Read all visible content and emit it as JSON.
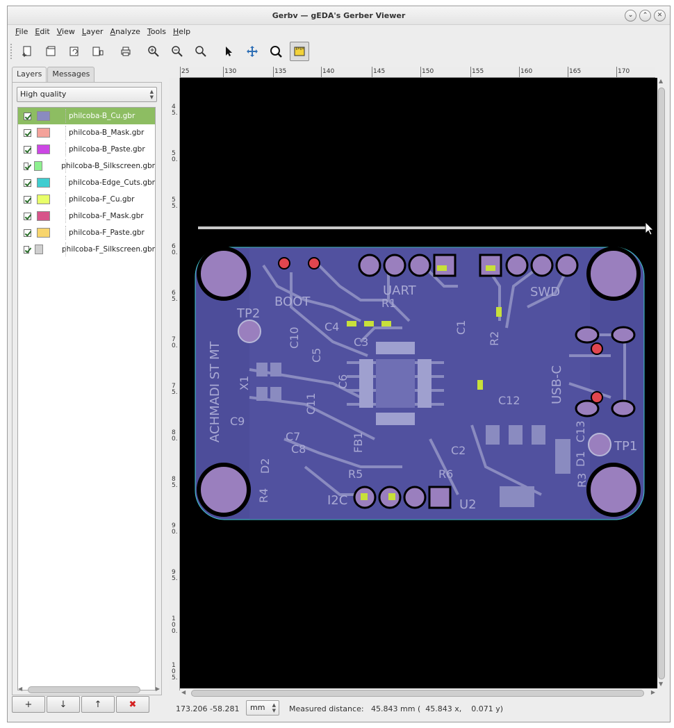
{
  "window": {
    "title": "Gerbv — gEDA's Gerber Viewer"
  },
  "menu": [
    "File",
    "Edit",
    "View",
    "Layer",
    "Analyze",
    "Tools",
    "Help"
  ],
  "toolbar": {
    "icons": [
      "new-project-icon",
      "open-project-icon",
      "revert-icon",
      "save-as-icon",
      "print-icon",
      "zoom-in-icon",
      "zoom-out-icon",
      "zoom-fit-icon",
      "pointer-tool-icon",
      "pan-tool-icon",
      "zoom-tool-icon",
      "measure-tool-icon"
    ],
    "active": "measure-tool-icon"
  },
  "sidebar": {
    "tabs": [
      "Layers",
      "Messages"
    ],
    "active_tab": "Layers",
    "render_mode": "High quality",
    "layers": [
      {
        "name": "philcoba-B_Cu.gbr",
        "color": "#8a8bc0",
        "visible": true,
        "selected": true
      },
      {
        "name": "philcoba-B_Mask.gbr",
        "color": "#f4a29a",
        "visible": true
      },
      {
        "name": "philcoba-B_Paste.gbr",
        "color": "#cc47e4",
        "visible": true
      },
      {
        "name": "philcoba-B_Silkscreen.gbr",
        "color": "#8ef08f",
        "visible": true
      },
      {
        "name": "philcoba-Edge_Cuts.gbr",
        "color": "#3fcdd0",
        "visible": true
      },
      {
        "name": "philcoba-F_Cu.gbr",
        "color": "#e8ff6a",
        "visible": true
      },
      {
        "name": "philcoba-F_Mask.gbr",
        "color": "#d7548a",
        "visible": true
      },
      {
        "name": "philcoba-F_Paste.gbr",
        "color": "#f8d56d",
        "visible": true
      },
      {
        "name": "philcoba-F_Silkscreen.gbr",
        "color": "#cfcfcf",
        "visible": true
      }
    ],
    "buttons": [
      "+",
      "↓",
      "↑",
      "✖"
    ]
  },
  "ruler": {
    "h_labels": [
      "25",
      "130",
      "135",
      "140",
      "145",
      "150",
      "155",
      "160",
      "165",
      "170"
    ],
    "v_labels": [
      "4\n5.",
      "5\n0.",
      "5\n5.",
      "6\n0.",
      "6\n5.",
      "7\n0.",
      "7\n5.",
      "8\n0.",
      "8\n5.",
      "9\n0.",
      "9\n5.",
      "1\n0\n0.",
      "1\n0\n5."
    ]
  },
  "board": {
    "silk_labels": [
      "BOOT",
      "UART",
      "R1",
      "SWD",
      "TP2",
      "C4",
      "C3",
      "C1",
      "R2",
      "USB-C",
      "X1",
      "C10",
      "C5",
      "C6",
      "C12",
      "ACHMADI ST MT",
      "C9",
      "C7",
      "C8",
      "C11",
      "FB1",
      "D1",
      "C13",
      "TP1",
      "R5",
      "R6",
      "C2",
      "R4",
      "R3",
      "I2C",
      "U2",
      "D2"
    ]
  },
  "status": {
    "coords": "173.206  -58.281",
    "unit": "mm",
    "measure": "Measured distance:   45.843 mm (  45.843 x,    0.071 y)"
  }
}
